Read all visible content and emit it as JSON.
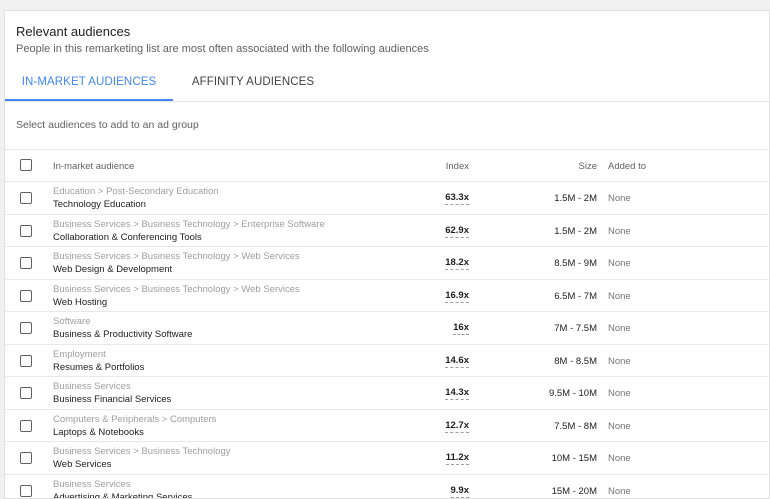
{
  "panel": {
    "title": "Relevant audiences",
    "subtitle": "People in this remarketing list are most often associated with the following audiences"
  },
  "tabs": [
    {
      "label": "IN-MARKET AUDIENCES",
      "active": true
    },
    {
      "label": "AFFINITY AUDIENCES",
      "active": false
    }
  ],
  "instruction": "Select audiences to add to an ad group",
  "table": {
    "headers": {
      "audience": "In-market audience",
      "index": "Index",
      "size": "Size",
      "added": "Added to"
    },
    "rows": [
      {
        "category": "Education > Post-Secondary Education",
        "name": "Technology Education",
        "index": "63.3x",
        "size": "1.5M - 2M",
        "added": "None"
      },
      {
        "category": "Business Services > Business Technology > Enterprise Software",
        "name": "Collaboration & Conferencing Tools",
        "index": "62.9x",
        "size": "1.5M - 2M",
        "added": "None"
      },
      {
        "category": "Business Services > Business Technology > Web Services",
        "name": "Web Design & Development",
        "index": "18.2x",
        "size": "8.5M - 9M",
        "added": "None"
      },
      {
        "category": "Business Services > Business Technology > Web Services",
        "name": "Web Hosting",
        "index": "16.9x",
        "size": "6.5M - 7M",
        "added": "None"
      },
      {
        "category": "Software",
        "name": "Business & Productivity Software",
        "index": "16x",
        "size": "7M - 7.5M",
        "added": "None"
      },
      {
        "category": "Employment",
        "name": "Resumes & Portfolios",
        "index": "14.6x",
        "size": "8M - 8.5M",
        "added": "None"
      },
      {
        "category": "Business Services",
        "name": "Business Financial Services",
        "index": "14.3x",
        "size": "9.5M - 10M",
        "added": "None"
      },
      {
        "category": "Computers & Peripherals > Computers",
        "name": "Laptops & Notebooks",
        "index": "12.7x",
        "size": "7.5M - 8M",
        "added": "None"
      },
      {
        "category": "Business Services > Business Technology",
        "name": "Web Services",
        "index": "11.2x",
        "size": "10M - 15M",
        "added": "None"
      },
      {
        "category": "Business Services",
        "name": "Advertising & Marketing Services",
        "index": "9.9x",
        "size": "15M - 20M",
        "added": "None"
      }
    ]
  }
}
